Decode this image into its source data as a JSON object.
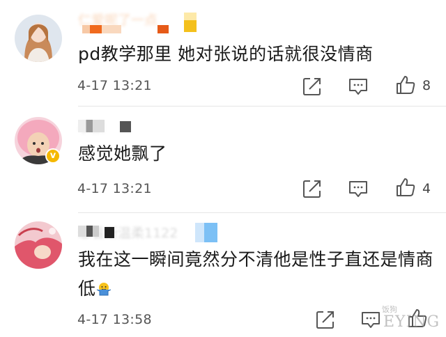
{
  "comments": [
    {
      "username": "仁爱呢了一点",
      "text": "pd教学那里 她对张说的话就很没情商",
      "time": "4-17 13:21",
      "likes": "8",
      "verified": false
    },
    {
      "username": "小狼",
      "text": "感觉她飘了",
      "time": "4-17 13:21",
      "likes": "4",
      "verified": true
    },
    {
      "username": "想看斯温柔1122",
      "text": "我在这一瞬间竟然分不清他是性子直还是情商低",
      "time": "4-17 13:58",
      "likes": "",
      "verified": false
    }
  ],
  "icons": {
    "share": "share-icon",
    "comment": "comment-icon",
    "like": "thumbs-up-icon",
    "emoji": "shrug-emoji-icon"
  },
  "watermark": {
    "small": "饭狗",
    "big": "EYING"
  },
  "colors": {
    "text": "#1a1a1a",
    "meta": "#555555",
    "icon": "#555555",
    "badge": "#f5b800"
  }
}
